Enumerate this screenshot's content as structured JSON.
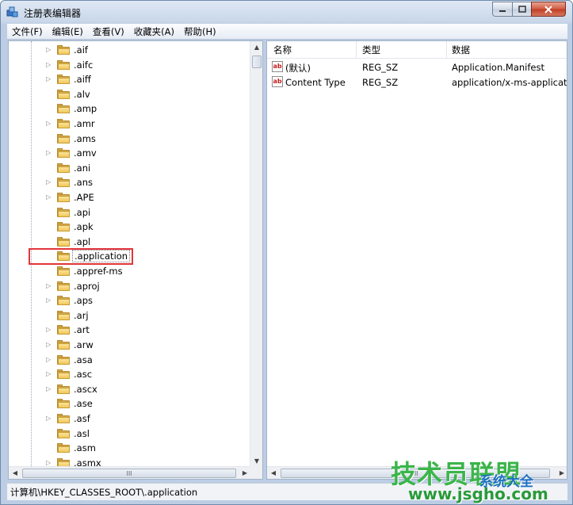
{
  "window": {
    "title": "注册表编辑器"
  },
  "menu": [
    "文件(F)",
    "编辑(E)",
    "查看(V)",
    "收藏夹(A)",
    "帮助(H)"
  ],
  "tree": {
    "items": [
      ".aif",
      ".aifc",
      ".aiff",
      ".alv",
      ".amp",
      ".amr",
      ".ams",
      ".amv",
      ".ani",
      ".ans",
      ".APE",
      ".api",
      ".apk",
      ".apl",
      ".application",
      ".appref-ms",
      ".aproj",
      ".aps",
      ".arj",
      ".art",
      ".arw",
      ".asa",
      ".asc",
      ".ascx",
      ".ase",
      ".asf",
      ".asl",
      ".asm",
      ".asmx"
    ],
    "expandable": [
      true,
      true,
      true,
      false,
      false,
      true,
      false,
      true,
      false,
      true,
      true,
      false,
      false,
      false,
      false,
      false,
      true,
      true,
      false,
      true,
      true,
      true,
      true,
      true,
      false,
      true,
      false,
      false,
      true
    ],
    "selected_index": 14,
    "hscroll_grip": "III"
  },
  "list": {
    "columns": [
      "名称",
      "类型",
      "数据"
    ],
    "rows": [
      {
        "name": "(默认)",
        "type": "REG_SZ",
        "data": "Application.Manifest"
      },
      {
        "name": "Content Type",
        "type": "REG_SZ",
        "data": "application/x-ms-applicatio"
      }
    ],
    "hscroll_grip": "III"
  },
  "status": {
    "path": "计算机\\HKEY_CLASSES_ROOT\\.application"
  },
  "watermark": {
    "brand": "技术员联盟",
    "sub": "系统大全",
    "url": "www.jsgho.com",
    "color": "#3bb54a"
  }
}
